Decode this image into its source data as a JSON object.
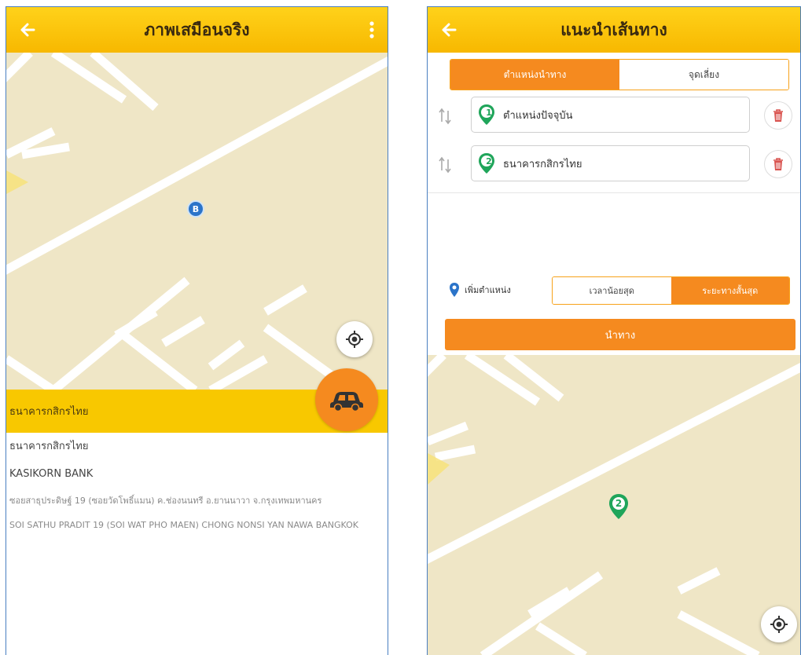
{
  "left_screen": {
    "title": "ภาพเสมือนจริง",
    "marker_label": "B",
    "info_bar_title": "ธนาคารกสิกรไทย",
    "place_name_th": "ธนาคารกสิกรไทย",
    "place_name_en": "KASIKORN BANK",
    "address_th": "ซอยสาธุประดิษฐ์ 19 (ซอยวัดโพธิ์แมน) ค.ช่องนนทรี อ.ยานนาวา จ.กรุงเทพมหานคร",
    "address_en": "SOI SATHU PRADIT 19 (SOI WAT PHO MAEN) CHONG NONSI YAN NAWA BANGKOK",
    "icons": [
      "back-arrow-icon",
      "more-vertical-icon",
      "locate-icon",
      "car-icon"
    ]
  },
  "right_screen": {
    "title": "แนะนำเส้นทาง",
    "tabs": [
      {
        "label": "ตำแหน่งนำทาง",
        "active": true
      },
      {
        "label": "จุดเลี่ยง",
        "active": false
      }
    ],
    "stops": [
      {
        "number": "1",
        "label": "ตำแหน่งปัจจุบัน"
      },
      {
        "number": "2",
        "label": "ธนาคารกสิกรไทย"
      }
    ],
    "add_location_label": "เพิ่มตำแหน่ง",
    "route_modes": [
      {
        "label": "เวลาน้อยสุด",
        "active": false
      },
      {
        "label": "ระยะทางสั้นสุด",
        "active": true
      }
    ],
    "navigate_label": "นำทาง",
    "map_marker_number": "2",
    "icons": [
      "back-arrow-icon",
      "reorder-icon",
      "trash-icon",
      "location-pin-icon",
      "locate-icon"
    ]
  },
  "colors": {
    "header_yellow": "#f8c800",
    "accent_orange": "#f58a1f",
    "map_background": "#efe6c6",
    "pin_green": "#1fa55a",
    "pin_blue": "#2b74c9",
    "trash_red": "#d9534f"
  }
}
